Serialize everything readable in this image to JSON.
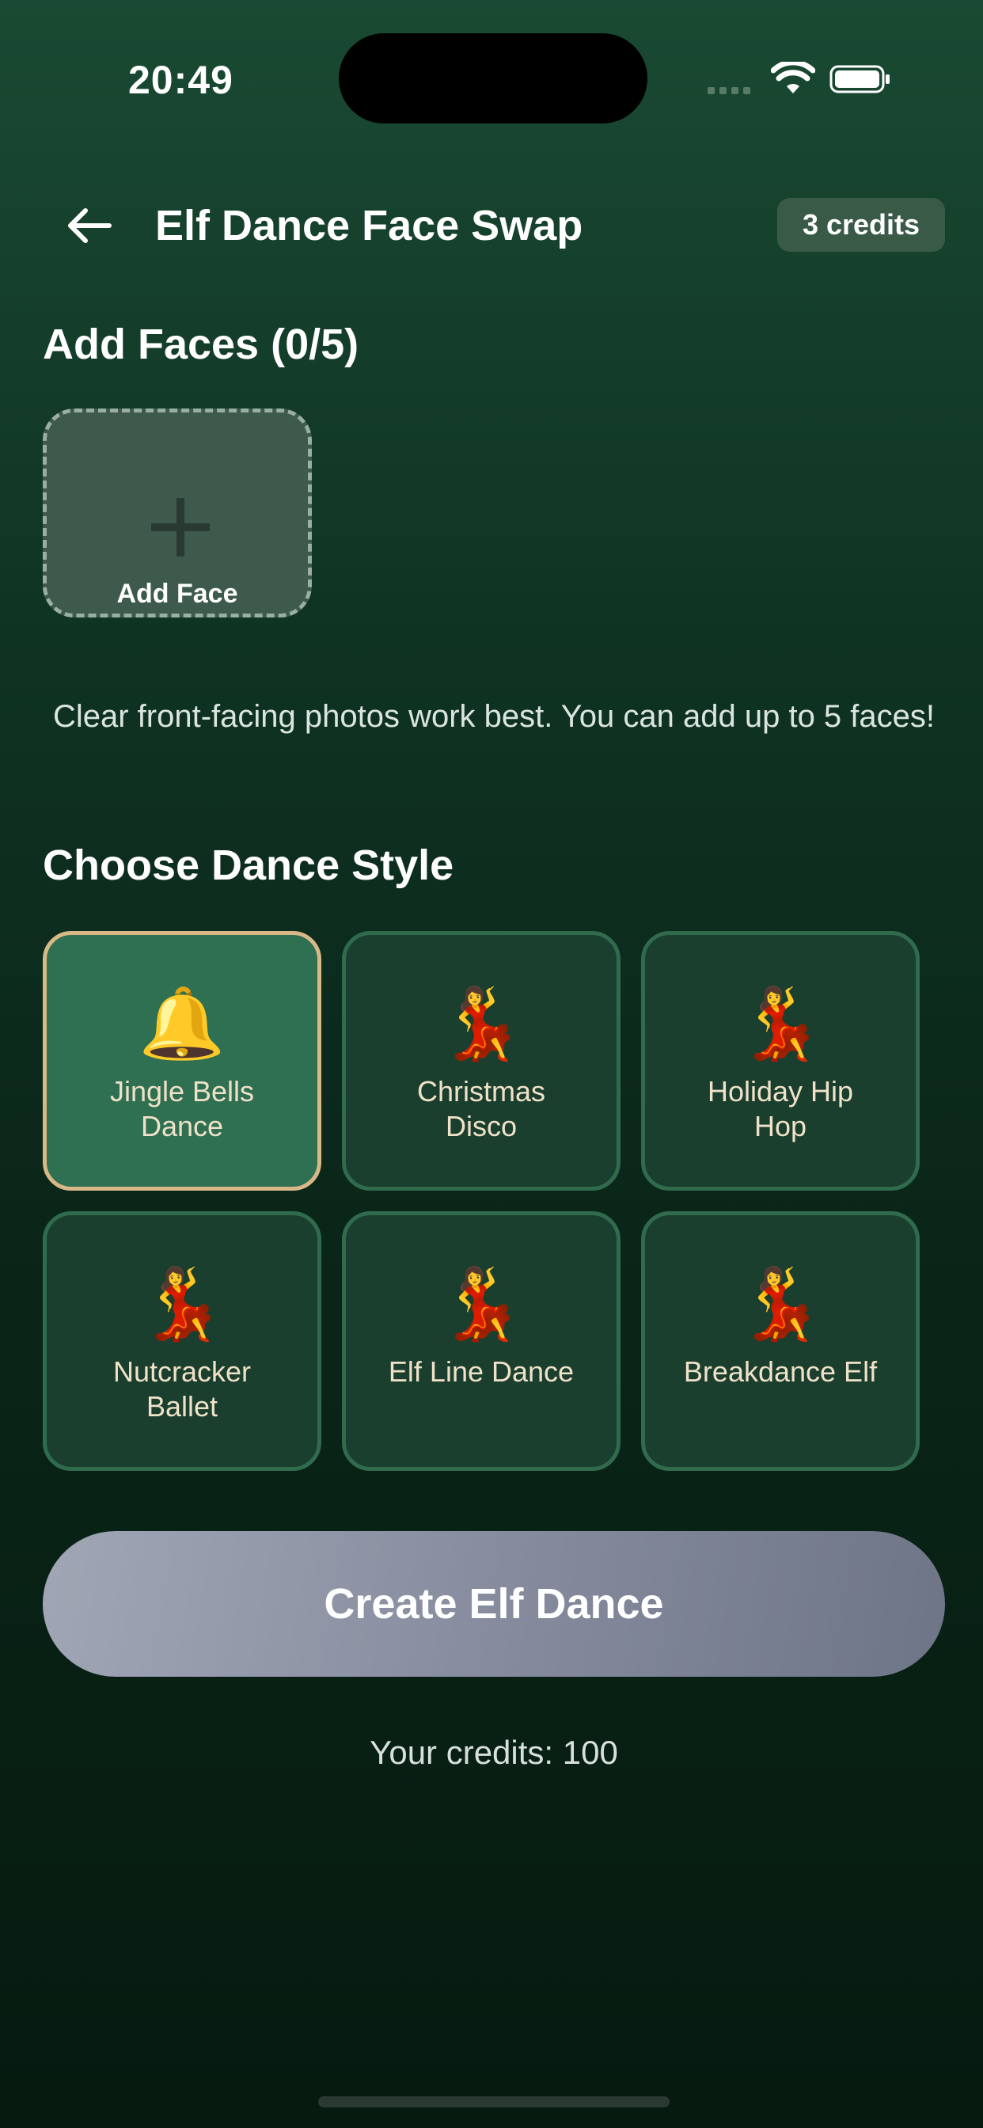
{
  "status_bar": {
    "time": "20:49"
  },
  "header": {
    "title": "Elf Dance Face Swap",
    "credits_badge": "3 credits",
    "back_icon": "arrow-left-icon"
  },
  "faces": {
    "title": "Add Faces (0/5)",
    "add_label": "Add Face",
    "hint": "Clear front-facing photos work best. You can add up to 5 faces!"
  },
  "dance": {
    "title": "Choose Dance Style",
    "styles": [
      {
        "emoji": "🔔",
        "label": "Jingle Bells Dance",
        "selected": true
      },
      {
        "emoji": "💃",
        "label": "Christmas Disco",
        "selected": false
      },
      {
        "emoji": "💃",
        "label": "Holiday Hip Hop",
        "selected": false
      },
      {
        "emoji": "💃",
        "label": "Nutcracker Ballet",
        "selected": false
      },
      {
        "emoji": "💃",
        "label": "Elf Line Dance",
        "selected": false
      },
      {
        "emoji": "💃",
        "label": "Breakdance Elf",
        "selected": false
      }
    ]
  },
  "actions": {
    "create_label": "Create Elf Dance"
  },
  "footer": {
    "credits_text": "Your credits: 100"
  },
  "colors": {
    "background_top": "#1a4a33",
    "background_bottom": "#061a10",
    "card_border": "#2f6b4c",
    "card_selected_border": "#d8b887",
    "card_selected_bg": "#2f7052",
    "button_gradient_start": "#a0a6b4",
    "button_gradient_end": "#6e7587"
  }
}
